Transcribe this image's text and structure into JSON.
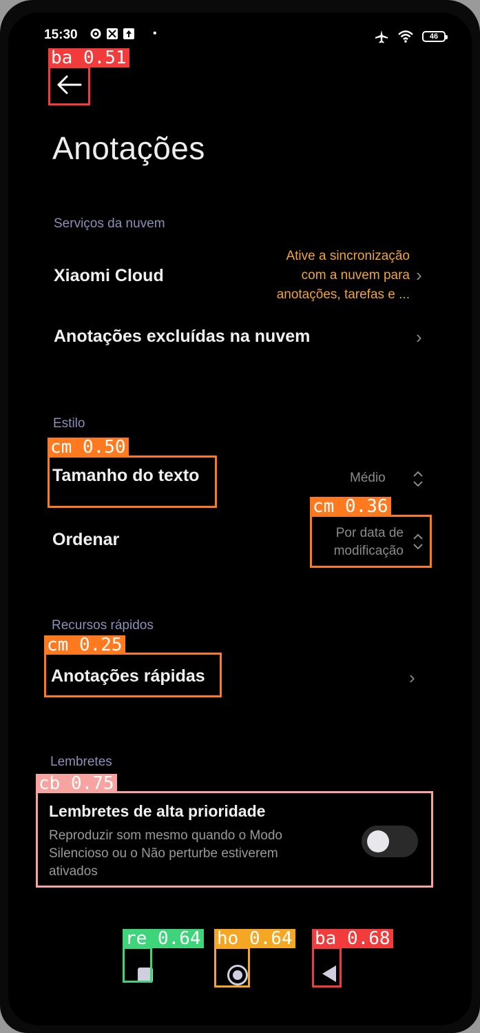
{
  "status_bar": {
    "time": "15:30",
    "battery_level": "46"
  },
  "header": {
    "title": "Anotações"
  },
  "sections": {
    "cloud": {
      "heading": "Serviços da nuvem",
      "xiaomi_cloud_label": "Xiaomi Cloud",
      "xiaomi_cloud_note_lines": [
        "Ative a sincronização",
        "com a nuvem para",
        "anotações, tarefas e ..."
      ],
      "deleted_notes_label": "Anotações excluídas na nuvem"
    },
    "style": {
      "heading": "Estilo",
      "text_size_label": "Tamanho do texto",
      "text_size_value": "Médio",
      "sort_label": "Ordenar",
      "sort_value_lines": [
        "Por data de",
        "modificação"
      ]
    },
    "quick": {
      "heading": "Recursos rápidos",
      "quick_notes_label": "Anotações rápidas"
    },
    "reminders": {
      "heading": "Lembretes",
      "high_priority_label": "Lembretes de alta prioridade",
      "high_priority_desc_lines": [
        "Reproduzir som mesmo quando o Modo",
        "Silencioso ou o Não perturbe estiverem",
        "ativados"
      ],
      "high_priority_enabled": false
    }
  },
  "detections": [
    {
      "label": "ba 0.51",
      "color": "#f23b3b"
    },
    {
      "label": "cm 0.50",
      "color": "#ff7a1e"
    },
    {
      "label": "cm 0.36",
      "color": "#ff7a1e"
    },
    {
      "label": "cm 0.25",
      "color": "#ff7a1e"
    },
    {
      "label": "cb 0.75",
      "color": "#f7a3a0"
    },
    {
      "label": "re 0.64",
      "color": "#3ed57a"
    },
    {
      "label": "ho 0.64",
      "color": "#f5a623"
    },
    {
      "label": "ba 0.68",
      "color": "#f23b3b"
    }
  ],
  "icons": {
    "back": "arrow-left-icon",
    "chevron": "chevron-right-icon",
    "updown": "chevron-updown-icon",
    "airplane": "airplane-icon",
    "wifi": "wifi-icon",
    "battery": "battery-icon"
  }
}
